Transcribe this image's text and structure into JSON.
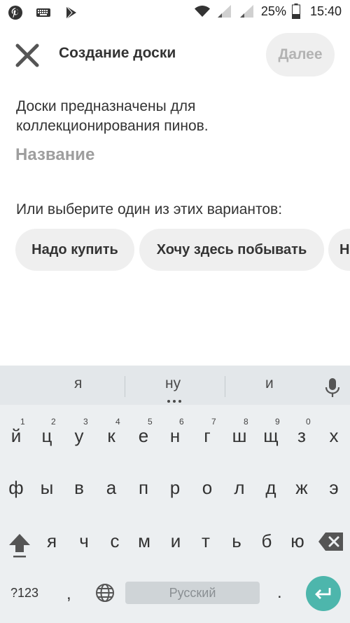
{
  "status_bar": {
    "left_icons": [
      "pinterest-icon",
      "keyboard-icon",
      "play-store-icon"
    ],
    "battery_percent": "25%",
    "time": "15:40"
  },
  "header": {
    "title": "Создание доски",
    "next_label": "Далее"
  },
  "main": {
    "description": "Доски предназначены для коллекционирования пинов.",
    "name_placeholder": "Название",
    "name_value": "",
    "choose_label": "Или выберите один из этих вариантов:",
    "chips": [
      "Надо купить",
      "Хочу здесь побывать",
      "Н"
    ]
  },
  "keyboard": {
    "suggestions": [
      "я",
      "ну",
      "и"
    ],
    "row1": [
      {
        "key": "й",
        "hint": "1"
      },
      {
        "key": "ц",
        "hint": "2"
      },
      {
        "key": "у",
        "hint": "3"
      },
      {
        "key": "к",
        "hint": "4"
      },
      {
        "key": "е",
        "hint": "5"
      },
      {
        "key": "н",
        "hint": "6"
      },
      {
        "key": "г",
        "hint": "7"
      },
      {
        "key": "ш",
        "hint": "8"
      },
      {
        "key": "щ",
        "hint": "9"
      },
      {
        "key": "з",
        "hint": "0"
      },
      {
        "key": "х",
        "hint": ""
      }
    ],
    "row2": [
      "ф",
      "ы",
      "в",
      "а",
      "п",
      "р",
      "о",
      "л",
      "д",
      "ж",
      "э"
    ],
    "row3": [
      "я",
      "ч",
      "с",
      "м",
      "и",
      "т",
      "ь",
      "б",
      "ю"
    ],
    "symbols_label": "?123",
    "comma": ",",
    "space_label": "Русский",
    "period": "."
  },
  "colors": {
    "keyboard_bg": "#eceff1",
    "enter_key": "#4db6ac",
    "chip_bg": "#efefef",
    "next_text": "#b3b3b3"
  }
}
